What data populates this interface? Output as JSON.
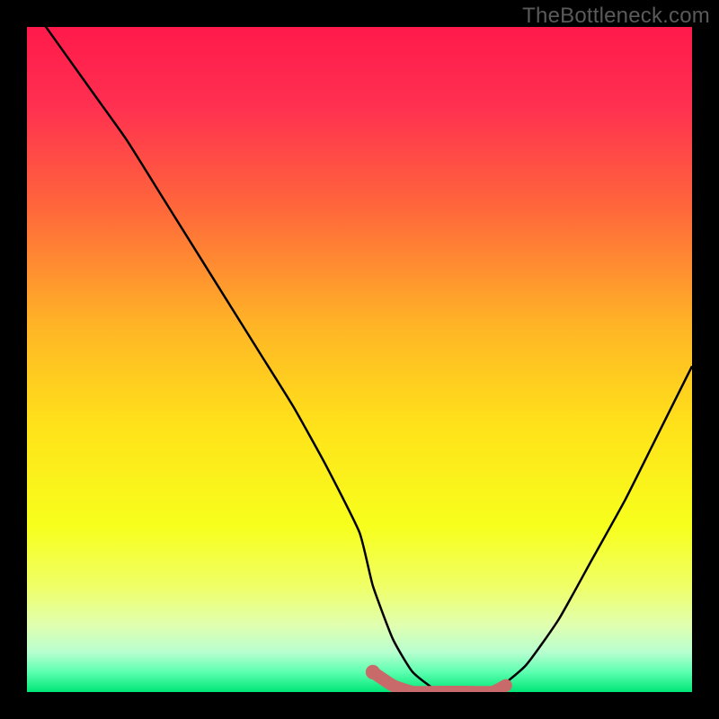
{
  "watermark": "TheBottleneck.com",
  "chart_data": {
    "type": "line",
    "title": "",
    "xlabel": "",
    "ylabel": "",
    "xlim": [
      0,
      100
    ],
    "ylim": [
      0,
      100
    ],
    "series": [
      {
        "name": "bottleneck-curve",
        "x": [
          0,
          5,
          10,
          15,
          20,
          25,
          30,
          35,
          40,
          45,
          50,
          52,
          55,
          58,
          62,
          66,
          70,
          75,
          80,
          85,
          90,
          95,
          100
        ],
        "values": [
          104,
          97,
          90,
          83,
          75,
          67,
          59,
          51,
          43,
          34,
          24,
          16,
          8,
          3,
          0,
          0,
          0,
          4,
          11,
          20,
          29,
          39,
          49
        ]
      },
      {
        "name": "optimal-segment",
        "x": [
          52,
          55,
          58,
          62,
          66,
          70,
          72
        ],
        "values": [
          3,
          1,
          0,
          0,
          0,
          0,
          1
        ]
      }
    ],
    "marker": {
      "x": 52,
      "y": 3
    },
    "gradient_stops": [
      {
        "pct": 0,
        "color": "#ff1a4b"
      },
      {
        "pct": 12,
        "color": "#ff3050"
      },
      {
        "pct": 28,
        "color": "#ff6a3a"
      },
      {
        "pct": 45,
        "color": "#ffb526"
      },
      {
        "pct": 60,
        "color": "#ffe21a"
      },
      {
        "pct": 75,
        "color": "#f7ff1c"
      },
      {
        "pct": 84,
        "color": "#f0ff66"
      },
      {
        "pct": 90,
        "color": "#e0ffb0"
      },
      {
        "pct": 94,
        "color": "#b8ffd0"
      },
      {
        "pct": 97,
        "color": "#5cffb0"
      },
      {
        "pct": 100,
        "color": "#00e676"
      }
    ],
    "colors": {
      "curve": "#000000",
      "optimal": "#c96a6a",
      "marker": "#c96a6a",
      "background_border": "#000000"
    }
  }
}
